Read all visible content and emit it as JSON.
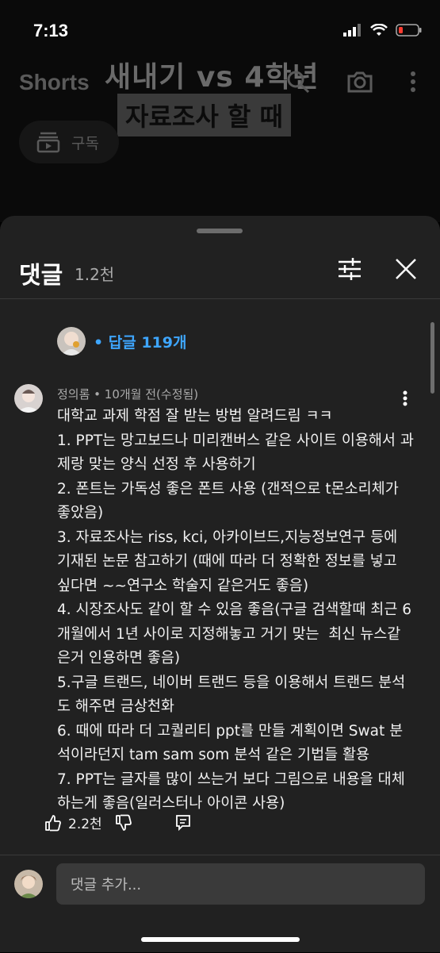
{
  "status": {
    "time": "7:13"
  },
  "video": {
    "shorts_label": "Shorts",
    "overlay_title": "새내기 vs 4학년",
    "overlay_subtitle": "자료조사 할 때",
    "subscribe_label": "구독"
  },
  "sheet": {
    "title": "댓글",
    "count": "1.2천"
  },
  "reply_link": "• 답글 119개",
  "comment": {
    "meta": "정의롬 • 10개월 전(수정됨)",
    "body": "대학교 과제 학점 잘 받는 방법 알려드림 ㅋㅋ\n1. PPT는 망고보드나 미리캔버스 같은 사이트 이용해서 과제랑 맞는 양식 선정 후 사용하기\n2. 폰트는 가독성 좋은 폰트 사용 (갠적으로 t몬소리체가 좋았음)\n3. 자료조사는 riss, kci, 아카이브드,지능정보연구 등에 기재된 논문 참고하기 (때에 따라 더 정확한 정보를 넣고 싶다면 ~~연구소 학술지 같은거도 좋음)\n4. 시장조사도 같이 할 수 있음 좋음(구글 검색할때 최근 6개월에서 1년 사이로 지정해놓고 거기 맞는  최신 뉴스같은거 인용하면 좋음)\n5.구글 트랜드, 네이버 트랜드 등을 이용해서 트랜드 분석도 해주면 금상천화\n6. 때에 따라 더 고퀄리티 ppt를 만들 계획이면 Swat 분석이라던지 tam sam som 분석 같은 기법들 활용\n7. PPT는 글자를 많이 쓰는거 보다 그림으로 내용을 대체 하는게 좋음(일러스터나 아이콘 사용)",
    "likes": "2.2천"
  },
  "add_comment": {
    "placeholder": "댓글 추가..."
  },
  "colors": {
    "accent": "#3ea6ff",
    "sheet_bg": "#212121",
    "input_bg": "#3a3a3a"
  }
}
